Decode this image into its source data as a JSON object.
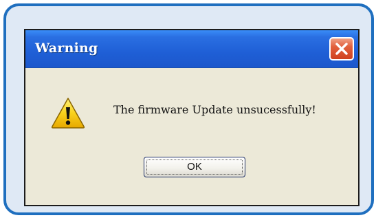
{
  "dialog": {
    "title": "Warning",
    "message": "The firmware Update unsucessfully!",
    "ok_label": "OK",
    "close_icon": "close-icon",
    "warning_icon": "warning-icon"
  },
  "colors": {
    "frame_border": "#1f6fbf",
    "frame_fill": "#dfe9f5",
    "titlebar": "#1f5fd6",
    "dialog_body": "#ece9d8",
    "close_button": "#d0401e",
    "warning_yellow": "#f5c400"
  }
}
